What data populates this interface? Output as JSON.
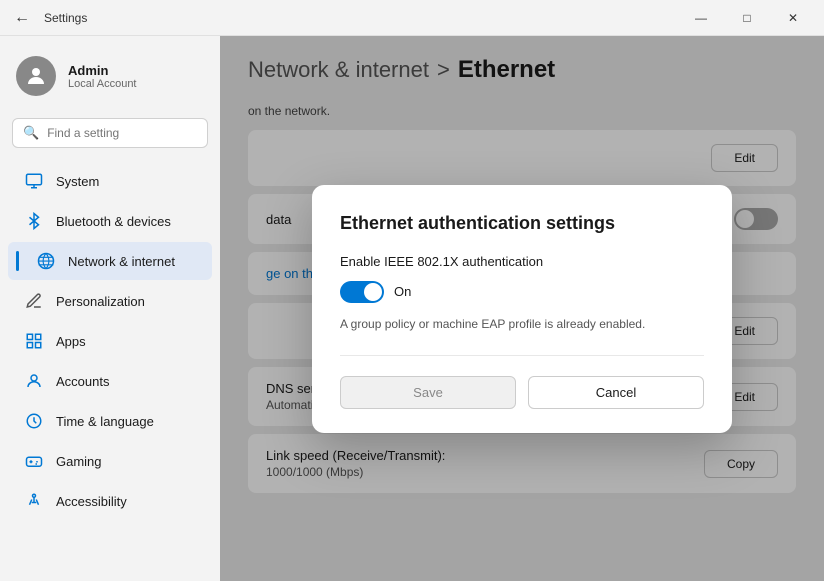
{
  "titleBar": {
    "title": "Settings",
    "minBtn": "—",
    "maxBtn": "□",
    "closeBtn": "✕"
  },
  "sidebar": {
    "user": {
      "name": "Admin",
      "subtitle": "Local Account"
    },
    "search": {
      "placeholder": "Find a setting"
    },
    "items": [
      {
        "id": "system",
        "label": "System",
        "icon": "⊞",
        "iconClass": "system"
      },
      {
        "id": "bluetooth",
        "label": "Bluetooth & devices",
        "icon": "◉",
        "iconClass": "bluetooth"
      },
      {
        "id": "network",
        "label": "Network & internet",
        "icon": "◈",
        "iconClass": "network",
        "active": true
      },
      {
        "id": "personalization",
        "label": "Personalization",
        "icon": "✏",
        "iconClass": "personalization"
      },
      {
        "id": "apps",
        "label": "Apps",
        "icon": "⊡",
        "iconClass": "apps"
      },
      {
        "id": "accounts",
        "label": "Accounts",
        "icon": "👤",
        "iconClass": "accounts"
      },
      {
        "id": "time",
        "label": "Time & language",
        "icon": "🕐",
        "iconClass": "time"
      },
      {
        "id": "gaming",
        "label": "Gaming",
        "icon": "🎮",
        "iconClass": "gaming"
      },
      {
        "id": "accessibility",
        "label": "Accessibility",
        "icon": "♿",
        "iconClass": "accessibility"
      }
    ]
  },
  "content": {
    "breadcrumb": "Network & internet",
    "separator": ">",
    "title": "Ethernet",
    "note": "on the network.",
    "rows": [
      {
        "type": "edit",
        "label": "",
        "value": "",
        "buttonLabel": "Edit"
      },
      {
        "type": "toggle",
        "label": "data",
        "toggleState": "Off",
        "buttonLabel": ""
      },
      {
        "type": "link",
        "linkText": "ge on this network"
      },
      {
        "type": "edit",
        "label": "",
        "value": "",
        "buttonLabel": "Edit"
      },
      {
        "type": "info-edit",
        "label": "DNS server assignment:",
        "value": "Automatic (DHCP)",
        "buttonLabel": "Edit"
      },
      {
        "type": "info-copy",
        "label": "Link speed (Receive/Transmit):",
        "value": "1000/1000 (Mbps)",
        "buttonLabel": "Copy"
      }
    ]
  },
  "dialog": {
    "title": "Ethernet authentication settings",
    "fieldLabel": "Enable IEEE 802.1X authentication",
    "toggleState": "On",
    "note": "A group policy or machine EAP profile is already enabled.",
    "saveLabel": "Save",
    "cancelLabel": "Cancel"
  }
}
